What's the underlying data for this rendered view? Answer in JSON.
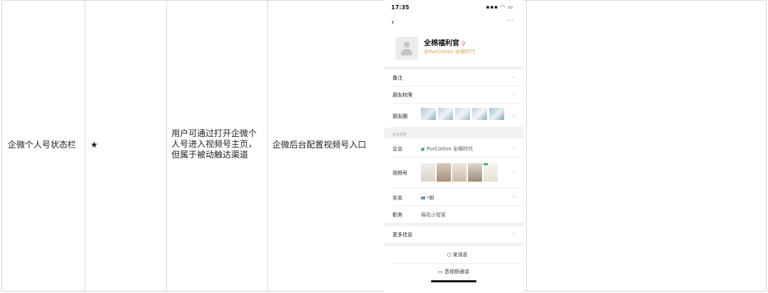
{
  "table": {
    "feature": "企微个人号状态栏",
    "rating": "★",
    "description_lines": [
      "用户可通过打开企微个",
      "人号进入视频号主页，",
      "但属于被动触达渠道"
    ],
    "config": "企微后台配置视频号入口"
  },
  "phone": {
    "status_bar": {
      "time": "17:35",
      "indicators": "▪▪▪ ◠ ▭"
    },
    "nav": {
      "back": "‹",
      "more": "···"
    },
    "profile": {
      "name": "全棉福利官",
      "gender": "♀",
      "company_alias": "@PurCotton 全棉时代"
    },
    "rows": {
      "remark": "备注",
      "friend_permission": "朋友权限",
      "moments": "朋友圈",
      "section_title": "企业信息",
      "enterprise_label": "企业",
      "enterprise_value": "PurCotton 全棉时代",
      "channels_label": "视频号",
      "realname_label": "实名",
      "realname_value": "*朝",
      "job_label": "职务",
      "job_value": "棉花小管家",
      "more_info": "更多信息"
    },
    "actions": {
      "message": "○ 发消息",
      "video_call": "▭ 音视频通话"
    },
    "arrow": "›",
    "colors": {
      "accent": "#d8a24c",
      "green": "#3cb371"
    }
  }
}
